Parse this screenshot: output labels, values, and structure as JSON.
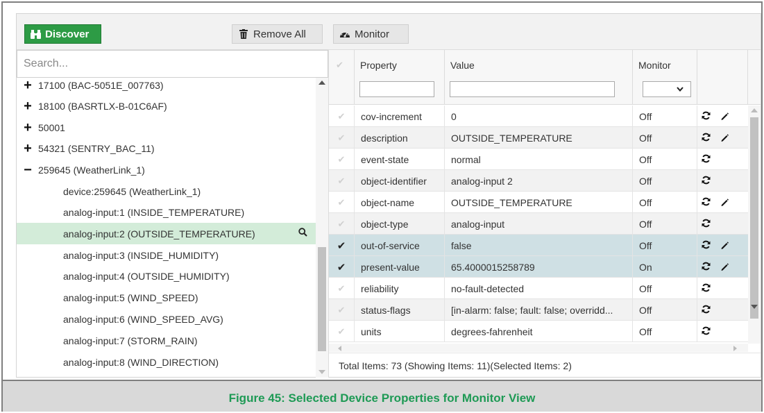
{
  "toolbar": {
    "discover_label": "Discover",
    "remove_all_label": "Remove All",
    "monitor_label": "Monitor"
  },
  "search": {
    "placeholder": "Search..."
  },
  "tree": {
    "items": [
      {
        "toggle": "+",
        "label": "17100 (BAC-5051E_007763)"
      },
      {
        "toggle": "+",
        "label": "18100 (BASRTLX-B-01C6AF)"
      },
      {
        "toggle": "+",
        "label": "50001"
      },
      {
        "toggle": "+",
        "label": "54321 (SENTRY_BAC_11)"
      },
      {
        "toggle": "−",
        "label": "259645 (WeatherLink_1)"
      },
      {
        "label": "device:259645 (WeatherLink_1)"
      },
      {
        "label": "analog-input:1 (INSIDE_TEMPERATURE)"
      },
      {
        "label": "analog-input:2 (OUTSIDE_TEMPERATURE)",
        "selected": true
      },
      {
        "label": "analog-input:3 (INSIDE_HUMIDITY)"
      },
      {
        "label": "analog-input:4 (OUTSIDE_HUMIDITY)"
      },
      {
        "label": "analog-input:5 (WIND_SPEED)"
      },
      {
        "label": "analog-input:6 (WIND_SPEED_AVG)"
      },
      {
        "label": "analog-input:7 (STORM_RAIN)"
      },
      {
        "label": "analog-input:8 (WIND_DIRECTION)"
      }
    ]
  },
  "grid": {
    "headers": {
      "property": "Property",
      "value": "Value",
      "monitor": "Monitor"
    },
    "rows": [
      {
        "property": "cov-increment",
        "value": "0",
        "monitor": "Off",
        "edit": true
      },
      {
        "property": "description",
        "value": "OUTSIDE_TEMPERATURE",
        "monitor": "Off",
        "edit": true
      },
      {
        "property": "event-state",
        "value": "normal",
        "monitor": "Off",
        "edit": false
      },
      {
        "property": "object-identifier",
        "value": "analog-input 2",
        "monitor": "Off",
        "edit": false
      },
      {
        "property": "object-name",
        "value": "OUTSIDE_TEMPERATURE",
        "monitor": "Off",
        "edit": true
      },
      {
        "property": "object-type",
        "value": "analog-input",
        "monitor": "Off",
        "edit": false
      },
      {
        "property": "out-of-service",
        "value": "false",
        "monitor": "Off",
        "edit": true,
        "checked": true
      },
      {
        "property": "present-value",
        "value": "65.4000015258789",
        "monitor": "On",
        "edit": true,
        "checked": true
      },
      {
        "property": "reliability",
        "value": "no-fault-detected",
        "monitor": "Off",
        "edit": false
      },
      {
        "property": "status-flags",
        "value": "[in-alarm: false; fault: false; overridd...",
        "monitor": "Off",
        "edit": false
      },
      {
        "property": "units",
        "value": "degrees-fahrenheit",
        "monitor": "Off",
        "edit": false
      }
    ],
    "footer": "Total Items: 73 (Showing Items: 11)(Selected Items: 2)"
  },
  "caption": "Figure 45: Selected Device Properties for Monitor View",
  "colors": {
    "accent_green": "#2d9b45",
    "caption_green": "#1e9a55",
    "selected_row": "#cfe0e4",
    "selected_tree": "#d3ecd9"
  },
  "icons": {
    "discover": "binoculars-icon",
    "remove_all": "trash-icon",
    "monitor": "gauge-icon",
    "refresh": "refresh-icon",
    "edit": "pencil-icon",
    "zoom": "search-icon"
  }
}
